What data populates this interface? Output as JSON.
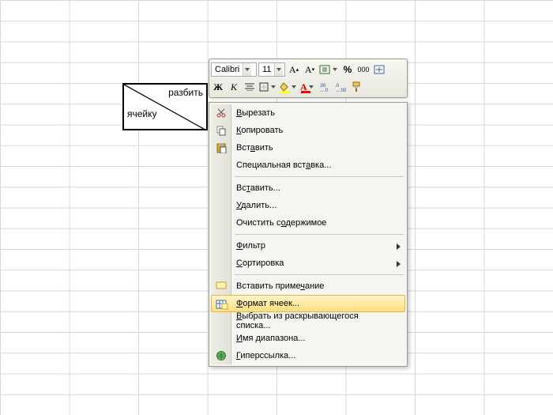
{
  "diag_cell": {
    "top_text": "разбить",
    "bottom_text": "ячейку"
  },
  "mini_toolbar": {
    "font_name": "Calibri",
    "font_size": "11",
    "percent": "%",
    "thousands": "000"
  },
  "context_menu": {
    "cut": "Вырезать",
    "copy": "Копировать",
    "paste": "Вставить",
    "paste_special": "Специальная вставка...",
    "insert": "Вставить...",
    "delete": "Удалить...",
    "clear": "Очистить содержимое",
    "filter": "Фильтр",
    "sort": "Сортировка",
    "comment": "Вставить примечание",
    "format_cells": "Формат ячеек...",
    "pick_list": "Выбрать из раскрывающегося списка...",
    "named_range": "Имя диапазона...",
    "hyperlink": "Гиперссылка..."
  }
}
